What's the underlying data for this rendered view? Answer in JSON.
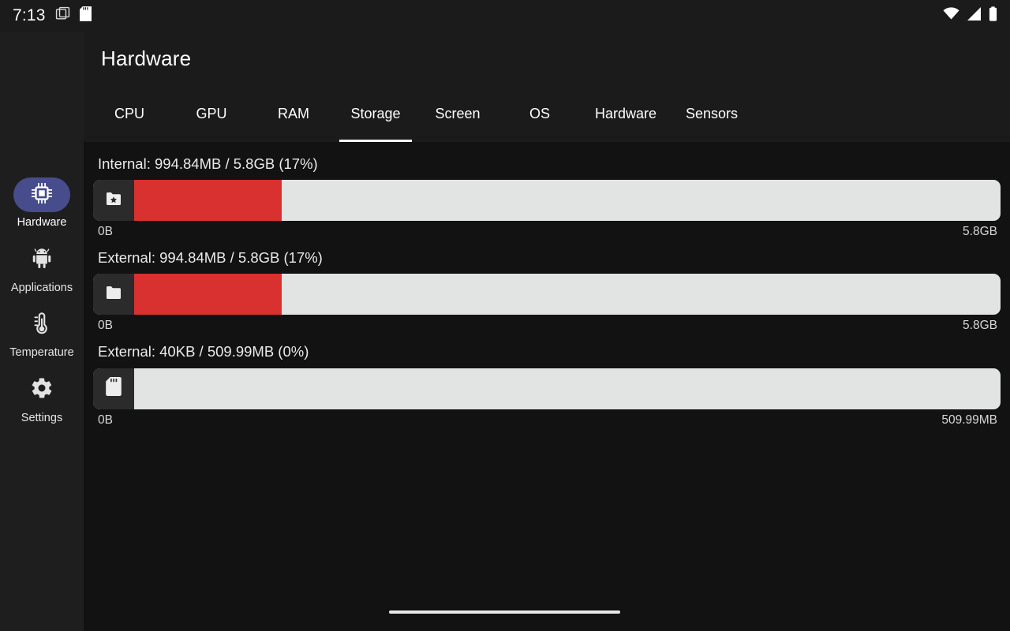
{
  "status_bar": {
    "time": "7:13",
    "left_icons": [
      "recent-apps-icon",
      "sd-card-icon"
    ],
    "right_icons": [
      "wifi-icon",
      "cellular-signal-icon",
      "battery-icon"
    ]
  },
  "header": {
    "title": "Hardware"
  },
  "sidebar": {
    "items": [
      {
        "label": "Hardware",
        "icon": "cpu-chip-icon",
        "active": true
      },
      {
        "label": "Applications",
        "icon": "android-robot-icon",
        "active": false
      },
      {
        "label": "Temperature",
        "icon": "thermometer-icon",
        "active": false
      },
      {
        "label": "Settings",
        "icon": "gear-icon",
        "active": false
      }
    ]
  },
  "tabs": {
    "items": [
      {
        "label": "CPU"
      },
      {
        "label": "GPU"
      },
      {
        "label": "RAM"
      },
      {
        "label": "Storage"
      },
      {
        "label": "Screen"
      },
      {
        "label": "OS"
      },
      {
        "label": "Hardware"
      },
      {
        "label": "Sensors"
      }
    ],
    "selected": "Storage"
  },
  "storage": {
    "rows": [
      {
        "title": "Internal: 994.84MB / 5.8GB (17%)",
        "icon": "folder-star-icon",
        "used_percent": 17,
        "min_label": "0B",
        "max_label": "5.8GB",
        "fill_color": "#d93030"
      },
      {
        "title": "External: 994.84MB / 5.8GB (17%)",
        "icon": "folder-icon",
        "used_percent": 17,
        "min_label": "0B",
        "max_label": "5.8GB",
        "fill_color": "#d93030"
      },
      {
        "title": "External: 40KB / 509.99MB (0%)",
        "icon": "sd-card-icon",
        "used_percent": 0,
        "min_label": "0B",
        "max_label": "509.99MB",
        "fill_color": "#d93030"
      }
    ]
  },
  "colors": {
    "background": "#121212",
    "surface": "#1b1b1b",
    "sidebar": "#1e1e1e",
    "accent": "#474c8d",
    "bar_track": "#e2e4e3",
    "bar_fill": "#d93030",
    "text": "#ffffff"
  },
  "navigation": {
    "home_indicator": "home-indicator"
  }
}
